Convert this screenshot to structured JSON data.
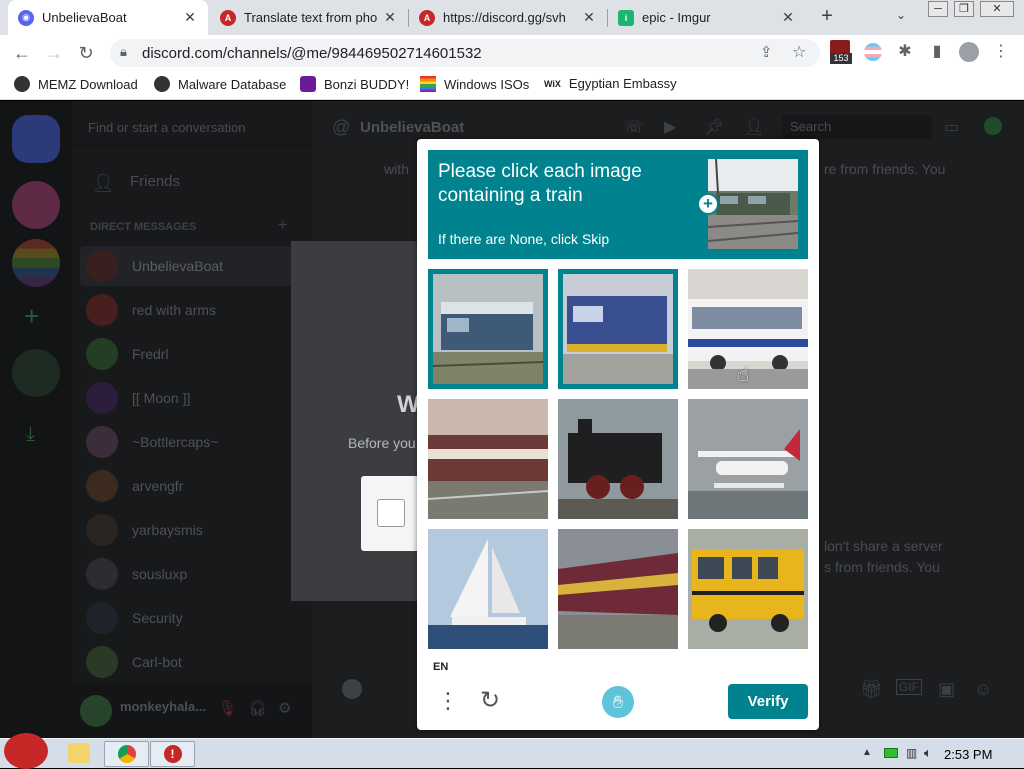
{
  "tabs": [
    {
      "title": "UnbelievaBoat",
      "active": true,
      "favicon_color": "#5865f2"
    },
    {
      "title": "Translate text from pho",
      "active": false,
      "favicon_color": "#c62828"
    },
    {
      "title": "https://discord.gg/svh",
      "active": false,
      "favicon_color": "#c62828"
    },
    {
      "title": "epic - Imgur",
      "active": false,
      "favicon_color": "#1bb76e"
    }
  ],
  "new_tab_label": "+",
  "omnibox": {
    "url": "discord.com/channels/@me/984469502714601532"
  },
  "extension_badge": "153",
  "bookmarks": [
    {
      "label": "MEMZ Download",
      "color": "#333"
    },
    {
      "label": "Malware Database",
      "color": "#333"
    },
    {
      "label": "Bonzi BUDDY!",
      "color": "#6a1b9a"
    },
    {
      "label": "Windows ISOs",
      "color": "#e53935"
    },
    {
      "label": "Egyptian Embassy",
      "color": "#000"
    }
  ],
  "discord": {
    "search_placeholder": "Find or start a conversation",
    "friends_label": "Friends",
    "direct_messages_header": "DIRECT MESSAGES",
    "dms": [
      "UnbelievaBoat",
      "red with arms",
      "Fredrl",
      "[[ Moon ]]",
      "~Bottlercaps~",
      "arvengfr",
      "yarbaysmis",
      "sousluxp",
      "Security",
      "Carl-bot"
    ],
    "current_user": "monkeyhala...",
    "channel_name": "UnbelievaBoat",
    "search_label": "Search",
    "bg_text_1": "with",
    "bg_text_2": "re from friends. You",
    "bg_text_3": "lon't share a server",
    "bg_text_4": "s from friends. You",
    "modal_title_frag": "W",
    "modal_text_frag": "Before you"
  },
  "captcha": {
    "prompt": "Please click each image containing a train",
    "skip_hint": "If there are None, click Skip",
    "cells": [
      {
        "subject": "train",
        "selected": true
      },
      {
        "subject": "train",
        "selected": true
      },
      {
        "subject": "bus",
        "selected": false
      },
      {
        "subject": "train",
        "selected": false
      },
      {
        "subject": "train",
        "selected": false
      },
      {
        "subject": "seaplane",
        "selected": false
      },
      {
        "subject": "sailboat",
        "selected": false
      },
      {
        "subject": "train",
        "selected": false
      },
      {
        "subject": "school bus",
        "selected": false
      }
    ],
    "language": "EN",
    "verify_label": "Verify",
    "accent_color": "#00838f"
  },
  "taskbar": {
    "time": "2:53 PM"
  }
}
